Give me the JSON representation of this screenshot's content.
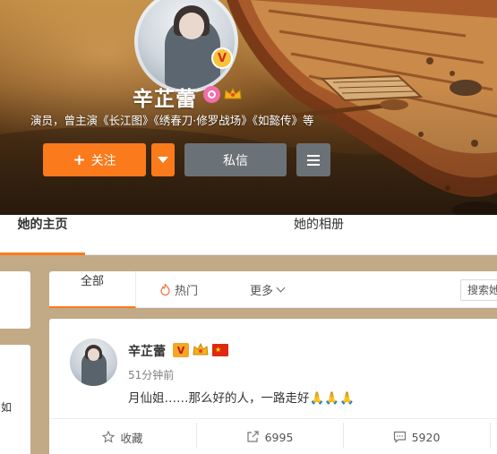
{
  "profile": {
    "name": "辛芷蕾",
    "bio": "演员，曾主演《长江图》《绣春刀·修罗战场》《如懿传》等",
    "verified_badge": "V",
    "icons": [
      "female-icon",
      "crown-icon"
    ]
  },
  "actions": {
    "follow_label": "关注",
    "follow_plus": "+",
    "message_label": "私信"
  },
  "nav": {
    "tabs": [
      {
        "label": "她的主页",
        "active": true
      },
      {
        "label": "她的相册",
        "active": false
      }
    ]
  },
  "sidebar": {
    "clipped_text": "如"
  },
  "filter": {
    "tabs": [
      {
        "label": "全部",
        "active": true
      },
      {
        "label": "热门",
        "icon": "flame-icon"
      },
      {
        "label": "更多",
        "icon": "chevron-down-icon"
      }
    ],
    "search_placeholder": "搜索她"
  },
  "post": {
    "author": "辛芷蕾",
    "time": "51分钟前",
    "text": "月仙姐……那么好的人，一路走好",
    "emoji": "🙏🙏🙏",
    "badges": [
      "verified-v-icon",
      "crown-icon",
      "china-flag-icon"
    ],
    "footer": {
      "favorite_label": "收藏",
      "repost_count": "6995",
      "comment_count": "5920"
    }
  },
  "colors": {
    "accent": "#fb7a1c",
    "secondary_button": "#6b7277",
    "page_bg": "#c2aa86"
  }
}
